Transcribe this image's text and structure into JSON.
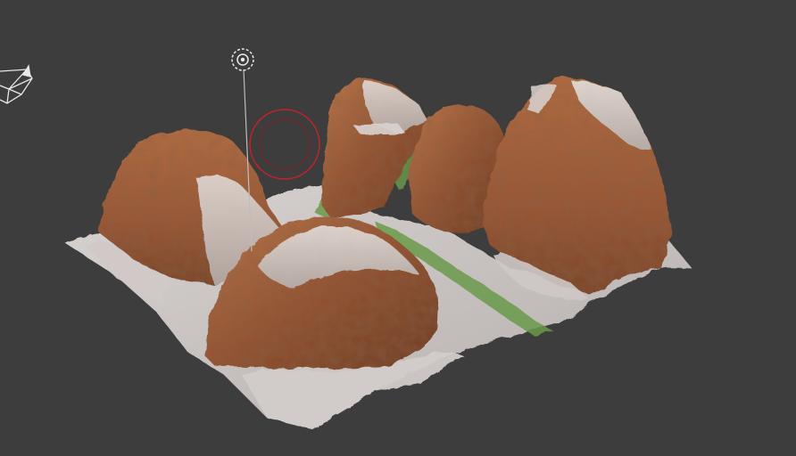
{
  "viewport": {
    "background_color": "#3d3d3d",
    "object": "terrain-mesh",
    "surface_colors": {
      "rock": "#a0603a",
      "rock_dark": "#6e3a20",
      "snow": "#d6d2d0",
      "grass": "#6a9a4a"
    },
    "gizmo_colors": {
      "camera": "#e8e8e8",
      "light": "#e8e8e8",
      "origin_circle": "#c0222a"
    }
  }
}
